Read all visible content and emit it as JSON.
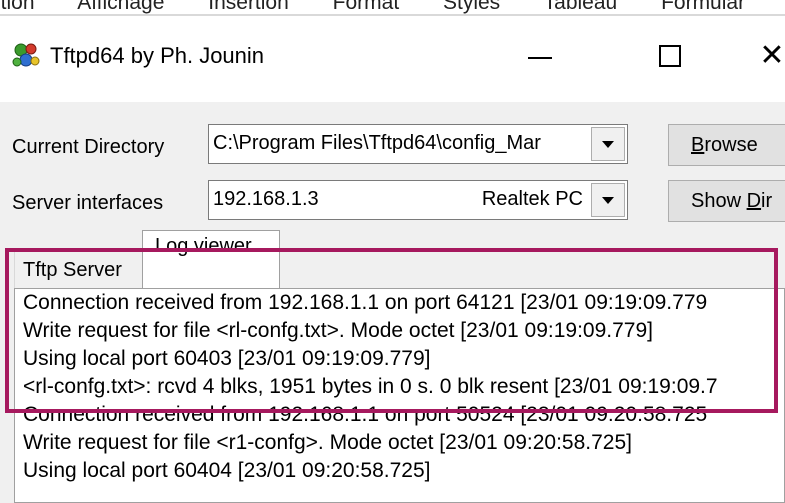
{
  "menubar": {
    "items": [
      "ition",
      "Affichage",
      "Insertion",
      "Format",
      "Styles",
      "Tableau",
      "Formular"
    ]
  },
  "window": {
    "title": "Tftpd64 by Ph. Jounin",
    "icon": "tftpd64-app-icon",
    "minimize_icon": "minimize-icon",
    "maximize_icon": "maximize-icon",
    "close_icon": "close-icon",
    "close_glyph": "✕"
  },
  "form": {
    "current_directory_label": "Current Directory",
    "current_directory_value": "C:\\Program Files\\Tftpd64\\config_Mar",
    "server_interfaces_label": "Server interfaces",
    "server_interfaces_ip": "192.168.1.3",
    "server_interfaces_adapter": "Realtek PC",
    "browse_button": {
      "prefix": "",
      "underlined": "B",
      "suffix": "rowse"
    },
    "show_dir_button": {
      "prefix": "Show ",
      "underlined": "D",
      "suffix": "ir"
    }
  },
  "tabs": [
    {
      "label": "Tftp Server",
      "active": false
    },
    {
      "label": "Log viewer",
      "active": true
    }
  ],
  "log": {
    "lines": [
      "Connection received from 192.168.1.1 on port 64121 [23/01 09:19:09.779",
      "Write request for file <rl-confg.txt>. Mode octet [23/01 09:19:09.779]",
      "Using local port 60403 [23/01 09:19:09.779]",
      "<rl-confg.txt>: rcvd 4 blks, 1951 bytes in 0 s. 0 blk resent [23/01 09:19:09.7",
      "Connection received from 192.168.1.1 on port 50524 [23/01 09:20:58.725",
      "Write request for file <r1-confg>. Mode octet [23/01 09:20:58.725]",
      "Using local port 60404 [23/01 09:20:58.725]"
    ]
  },
  "annotation": {
    "highlight_color": "#a6195e"
  }
}
